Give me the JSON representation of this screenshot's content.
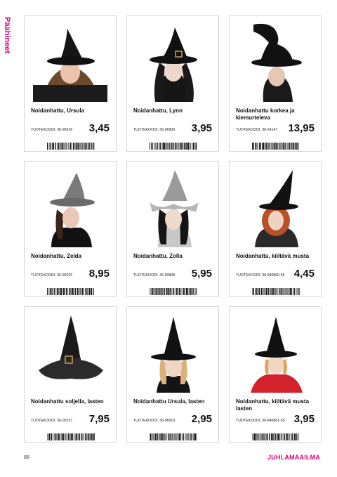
{
  "side_heading": "Päähineet",
  "code_label": "TUOTEKOODI:",
  "products": [
    {
      "title": "Noidanhattu, Ursula",
      "code": "36-96918",
      "price": "3,45",
      "hat_color": "#111111"
    },
    {
      "title": "Noidanhattu, Lynn",
      "code": "36-96900",
      "price": "3,95",
      "hat_color": "#111111"
    },
    {
      "title": "Noidanhattu korkea ja kiemurteleva",
      "code": "36-24147",
      "price": "13,95",
      "hat_color": "#111111"
    },
    {
      "title": "Noidanhattu, Zelda",
      "code": "36-96925",
      "price": "8,95",
      "hat_color": "#7a7a7a"
    },
    {
      "title": "Noidanhattu, Zolla",
      "code": "36-00808",
      "price": "5,95",
      "hat_color": "#9a9a9a"
    },
    {
      "title": "Noidanhattu, kiiltävä musta",
      "code": "36-840860-55",
      "price": "4,45",
      "hat_color": "#111111"
    },
    {
      "title": "Noidanhattu soljella, lasten",
      "code": "36-00157",
      "price": "7,95",
      "hat_color": "#1a1a1a"
    },
    {
      "title": "Noidanhattu Ursula, lasten",
      "code": "36-96919",
      "price": "2,95",
      "hat_color": "#111111"
    },
    {
      "title": "Noidanhattu, kiiltävä musta lasten",
      "code": "36-840861-55",
      "price": "3,95",
      "hat_color": "#111111"
    }
  ],
  "page_number": "68",
  "brand": "JUHLAMAAILMA",
  "colors": {
    "accent": "#e0007a",
    "border": "#d6d6d6"
  }
}
